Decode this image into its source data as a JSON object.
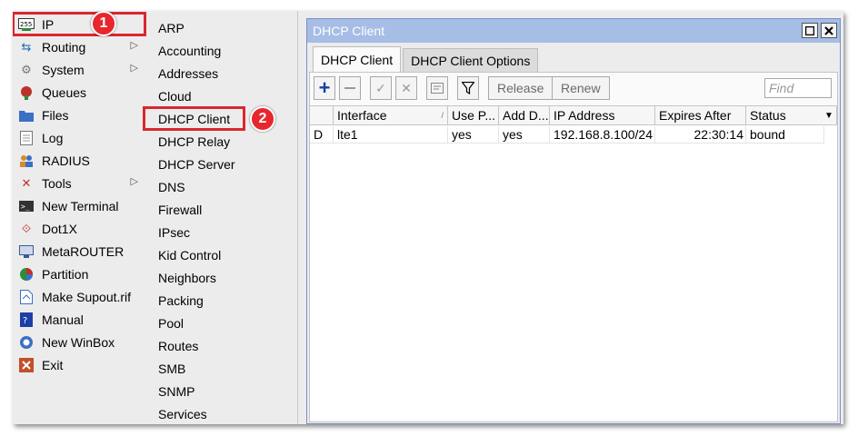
{
  "menu": {
    "items": [
      {
        "label": "IP",
        "icon": "ip-icon",
        "submenu": true
      },
      {
        "label": "Routing",
        "icon": "routing-icon",
        "submenu": true
      },
      {
        "label": "System",
        "icon": "gear-icon",
        "submenu": true
      },
      {
        "label": "Queues",
        "icon": "queues-icon",
        "submenu": false
      },
      {
        "label": "Files",
        "icon": "folder-icon",
        "submenu": false
      },
      {
        "label": "Log",
        "icon": "log-icon",
        "submenu": false
      },
      {
        "label": "RADIUS",
        "icon": "users-icon",
        "submenu": false
      },
      {
        "label": "Tools",
        "icon": "tools-icon",
        "submenu": true
      },
      {
        "label": "New Terminal",
        "icon": "terminal-icon",
        "submenu": false
      },
      {
        "label": "Dot1X",
        "icon": "dot1x-icon",
        "submenu": false
      },
      {
        "label": "MetaROUTER",
        "icon": "metarouter-icon",
        "submenu": false
      },
      {
        "label": "Partition",
        "icon": "pie-icon",
        "submenu": false
      },
      {
        "label": "Make Supout.rif",
        "icon": "document-icon",
        "submenu": false
      },
      {
        "label": "Manual",
        "icon": "book-icon",
        "submenu": false
      },
      {
        "label": "New WinBox",
        "icon": "winbox-icon",
        "submenu": false
      },
      {
        "label": "Exit",
        "icon": "exit-icon",
        "submenu": false
      }
    ],
    "submenu_arrow": "▷"
  },
  "submenu": {
    "items": [
      "ARP",
      "Accounting",
      "Addresses",
      "Cloud",
      "DHCP Client",
      "DHCP Relay",
      "DHCP Server",
      "DNS",
      "Firewall",
      "IPsec",
      "Kid Control",
      "Neighbors",
      "Packing",
      "Pool",
      "Routes",
      "SMB",
      "SNMP",
      "Services"
    ]
  },
  "badges": {
    "one": "1",
    "two": "2"
  },
  "window": {
    "title": "DHCP Client",
    "tabs": [
      "DHCP Client",
      "DHCP Client Options"
    ],
    "toolbar": {
      "release": "Release",
      "renew": "Renew",
      "find_placeholder": "Find"
    },
    "columns": [
      "",
      "Interface",
      "Use P...",
      "Add D...",
      "IP Address",
      "Expires After",
      "Status"
    ],
    "rows": [
      {
        "flag": "D",
        "interface": "lte1",
        "use_peer_dns": "yes",
        "add_default_route": "yes",
        "ip_address": "192.168.8.100/24",
        "expires_after": "22:30:14",
        "status": "bound"
      }
    ]
  },
  "colors": {
    "titlebar": "#a6bde5",
    "highlight": "#d9272e",
    "accent_blue": "#1b3fa7"
  }
}
